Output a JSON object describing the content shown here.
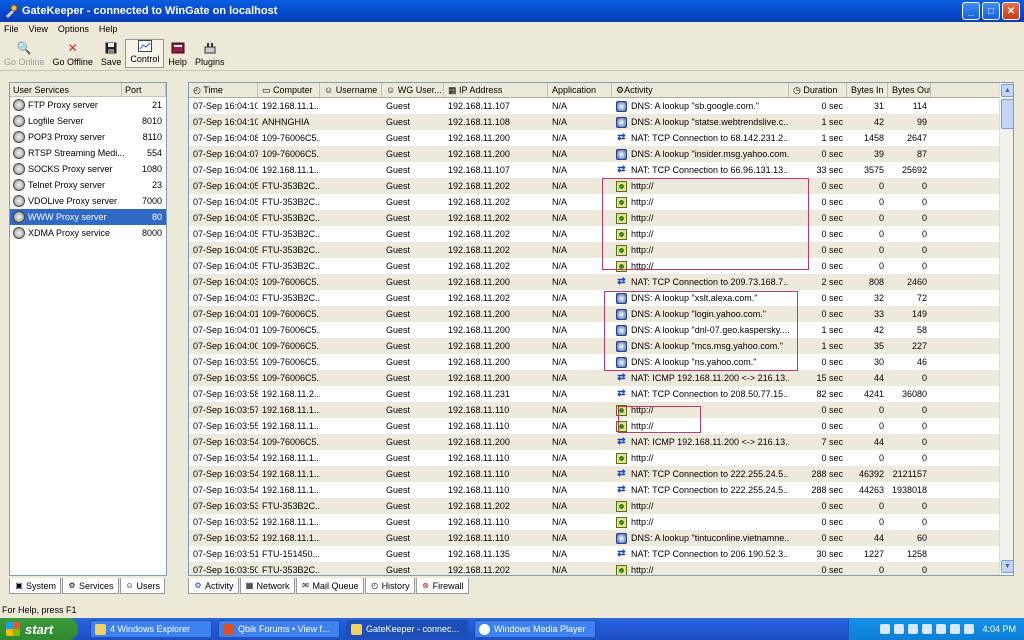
{
  "window": {
    "title": "GateKeeper - connected to WinGate on localhost"
  },
  "menu": [
    "File",
    "View",
    "Options",
    "Help"
  ],
  "toolbar": [
    {
      "label": "Go Online",
      "icon": "go-online-icon",
      "state": "disabled"
    },
    {
      "label": "Go Offline",
      "icon": "go-offline-icon",
      "state": "normal"
    },
    {
      "label": "Save",
      "icon": "save-icon",
      "state": "normal"
    },
    {
      "label": "Control",
      "icon": "control-icon",
      "state": "pressed"
    },
    {
      "label": "Help",
      "icon": "help-book-icon",
      "state": "normal"
    },
    {
      "label": "Plugins",
      "icon": "plugins-icon",
      "state": "normal"
    }
  ],
  "services": {
    "header_name": "User Services",
    "header_port": "Port",
    "items": [
      {
        "name": "FTP Proxy server",
        "port": "21"
      },
      {
        "name": "Logfile Server",
        "port": "8010"
      },
      {
        "name": "POP3 Proxy server",
        "port": "8110"
      },
      {
        "name": "RTSP Streaming Medi...",
        "port": "554"
      },
      {
        "name": "SOCKS Proxy server",
        "port": "1080"
      },
      {
        "name": "Telnet Proxy server",
        "port": "23"
      },
      {
        "name": "VDOLive Proxy server",
        "port": "7000"
      },
      {
        "name": "WWW Proxy server",
        "port": "80"
      },
      {
        "name": "XDMA Proxy service",
        "port": "8000"
      }
    ],
    "selected_index": 7
  },
  "left_tabs": [
    "System",
    "Services",
    "Users"
  ],
  "columns": [
    "Time",
    "Computer",
    "Username",
    "WG User...",
    "IP Address",
    "Application",
    "Activity",
    "Duration",
    "Bytes In",
    "Bytes Out"
  ],
  "rows": [
    [
      "07-Sep 16:04:10",
      "192.168.11.1...",
      "",
      "Guest",
      "192.168.11.107",
      "N/A",
      "dns",
      "DNS: A lookup \"sb.google.com.\"",
      "0 sec",
      "31",
      "114"
    ],
    [
      "07-Sep 16:04:10",
      "ANHNGHIA",
      "",
      "Guest",
      "192.168.11.108",
      "N/A",
      "dns",
      "DNS: A lookup \"statse.webtrendslive.c...",
      "1 sec",
      "42",
      "99"
    ],
    [
      "07-Sep 16:04:08",
      "109-76006C5...",
      "",
      "Guest",
      "192.168.11.200",
      "N/A",
      "nat",
      "NAT: TCP Connection to 68.142.231.2...",
      "1 sec",
      "1458",
      "2647"
    ],
    [
      "07-Sep 16:04:07",
      "109-76006C5...",
      "",
      "Guest",
      "192.168.11.200",
      "N/A",
      "dns",
      "DNS: A lookup \"insider.msg.yahoo.com.\"",
      "0 sec",
      "39",
      "87"
    ],
    [
      "07-Sep 16:04:06",
      "192.168.11.1...",
      "",
      "Guest",
      "192.168.11.107",
      "N/A",
      "nat",
      "NAT: TCP Connection to 66.96.131.13...",
      "33 sec",
      "3575",
      "25692"
    ],
    [
      "07-Sep 16:04:05",
      "FTU-353B2C...",
      "",
      "Guest",
      "192.168.11.202",
      "N/A",
      "http",
      "http://",
      "0 sec",
      "0",
      "0"
    ],
    [
      "07-Sep 16:04:05",
      "FTU-353B2C...",
      "",
      "Guest",
      "192.168.11.202",
      "N/A",
      "http",
      "http://",
      "0 sec",
      "0",
      "0"
    ],
    [
      "07-Sep 16:04:05",
      "FTU-353B2C...",
      "",
      "Guest",
      "192.168.11.202",
      "N/A",
      "http",
      "http://",
      "0 sec",
      "0",
      "0"
    ],
    [
      "07-Sep 16:04:05",
      "FTU-353B2C...",
      "",
      "Guest",
      "192.168.11.202",
      "N/A",
      "http",
      "http://",
      "0 sec",
      "0",
      "0"
    ],
    [
      "07-Sep 16:04:05",
      "FTU-353B2C...",
      "",
      "Guest",
      "192.168.11.202",
      "N/A",
      "http",
      "http://",
      "0 sec",
      "0",
      "0"
    ],
    [
      "07-Sep 16:04:05",
      "FTU-353B2C...",
      "",
      "Guest",
      "192.168.11.202",
      "N/A",
      "http",
      "http://",
      "0 sec",
      "0",
      "0"
    ],
    [
      "07-Sep 16:04:03",
      "109-76006C5...",
      "",
      "Guest",
      "192.168.11.200",
      "N/A",
      "nat",
      "NAT: TCP Connection to 209.73.168.7...",
      "2 sec",
      "808",
      "2460"
    ],
    [
      "07-Sep 16:04:03",
      "FTU-353B2C...",
      "",
      "Guest",
      "192.168.11.202",
      "N/A",
      "dns",
      "DNS: A lookup \"xslt.alexa.com.\"",
      "0 sec",
      "32",
      "72"
    ],
    [
      "07-Sep 16:04:01",
      "109-76006C5...",
      "",
      "Guest",
      "192.168.11.200",
      "N/A",
      "dns",
      "DNS: A lookup \"login.yahoo.com.\"",
      "0 sec",
      "33",
      "149"
    ],
    [
      "07-Sep 16:04:01",
      "109-76006C5...",
      "",
      "Guest",
      "192.168.11.200",
      "N/A",
      "dns",
      "DNS: A lookup \"dnl-07.geo.kaspersky....",
      "1 sec",
      "42",
      "58"
    ],
    [
      "07-Sep 16:04:00",
      "109-76006C5...",
      "",
      "Guest",
      "192.168.11.200",
      "N/A",
      "dns",
      "DNS: A lookup \"mcs.msg.yahoo.com.\"",
      "1 sec",
      "35",
      "227"
    ],
    [
      "07-Sep 16:03:59",
      "109-76006C5...",
      "",
      "Guest",
      "192.168.11.200",
      "N/A",
      "dns",
      "DNS: A lookup \"ns.yahoo.com.\"",
      "0 sec",
      "30",
      "46"
    ],
    [
      "07-Sep 16:03:59",
      "109-76006C5...",
      "",
      "Guest",
      "192.168.11.200",
      "N/A",
      "nat",
      "NAT: ICMP 192.168.11.200 <-> 216.13...",
      "15 sec",
      "44",
      "0"
    ],
    [
      "07-Sep 16:03:58",
      "192.168.11.2...",
      "",
      "Guest",
      "192.168.11.231",
      "N/A",
      "nat",
      "NAT: TCP Connection to 208.50.77.15...",
      "82 sec",
      "4241",
      "36080"
    ],
    [
      "07-Sep 16:03:57",
      "192.168.11.1...",
      "",
      "Guest",
      "192.168.11.110",
      "N/A",
      "http",
      "http://",
      "0 sec",
      "0",
      "0"
    ],
    [
      "07-Sep 16:03:55",
      "192.168.11.1...",
      "",
      "Guest",
      "192.168.11.110",
      "N/A",
      "http",
      "http://",
      "0 sec",
      "0",
      "0"
    ],
    [
      "07-Sep 16:03:54",
      "109-76006C5...",
      "",
      "Guest",
      "192.168.11.200",
      "N/A",
      "nat",
      "NAT: ICMP 192.168.11.200 <-> 216.13...",
      "7 sec",
      "44",
      "0"
    ],
    [
      "07-Sep 16:03:54",
      "192.168.11.1...",
      "",
      "Guest",
      "192.168.11.110",
      "N/A",
      "http",
      "http://",
      "0 sec",
      "0",
      "0"
    ],
    [
      "07-Sep 16:03:54",
      "192.168.11.1...",
      "",
      "Guest",
      "192.168.11.110",
      "N/A",
      "nat",
      "NAT: TCP Connection to 222.255.24.5...",
      "288 sec",
      "46392",
      "2121157"
    ],
    [
      "07-Sep 16:03:54",
      "192.168.11.1...",
      "",
      "Guest",
      "192.168.11.110",
      "N/A",
      "nat",
      "NAT: TCP Connection to 222.255.24.5...",
      "288 sec",
      "44263",
      "1938018"
    ],
    [
      "07-Sep 16:03:53",
      "FTU-353B2C...",
      "",
      "Guest",
      "192.168.11.202",
      "N/A",
      "http",
      "http://",
      "0 sec",
      "0",
      "0"
    ],
    [
      "07-Sep 16:03:52",
      "192.168.11.1...",
      "",
      "Guest",
      "192.168.11.110",
      "N/A",
      "http",
      "http://",
      "0 sec",
      "0",
      "0"
    ],
    [
      "07-Sep 16:03:52",
      "192.168.11.1...",
      "",
      "Guest",
      "192.168.11.110",
      "N/A",
      "dns",
      "DNS: A lookup \"tintuconline.vietnamne...",
      "0 sec",
      "44",
      "60"
    ],
    [
      "07-Sep 16:03:51",
      "FTU-151450...",
      "",
      "Guest",
      "192.168.11.135",
      "N/A",
      "nat",
      "NAT: TCP Connection to 206.190.52.3...",
      "30 sec",
      "1227",
      "1258"
    ],
    [
      "07-Sep 16:03:50",
      "FTU-353B2C...",
      "",
      "Guest",
      "192.168.11.202",
      "N/A",
      "http",
      "http://",
      "0 sec",
      "0",
      "0"
    ]
  ],
  "main_tabs": [
    "Activity",
    "Network",
    "Mail Queue",
    "History",
    "Firewall"
  ],
  "main_tab_active": 3,
  "status": "For Help, press F1",
  "taskbar": {
    "start": "start",
    "tasks": [
      "4 Windows Explorer",
      "Qbik Forums • View f...",
      "GateKeeper - connec...",
      "Windows Media Player"
    ],
    "active_task": 2,
    "clock": "4:04 PM"
  },
  "colors": {
    "selection": "#316ac5",
    "highlight_box": "#c0396a",
    "title_bar": "#0547c9"
  }
}
